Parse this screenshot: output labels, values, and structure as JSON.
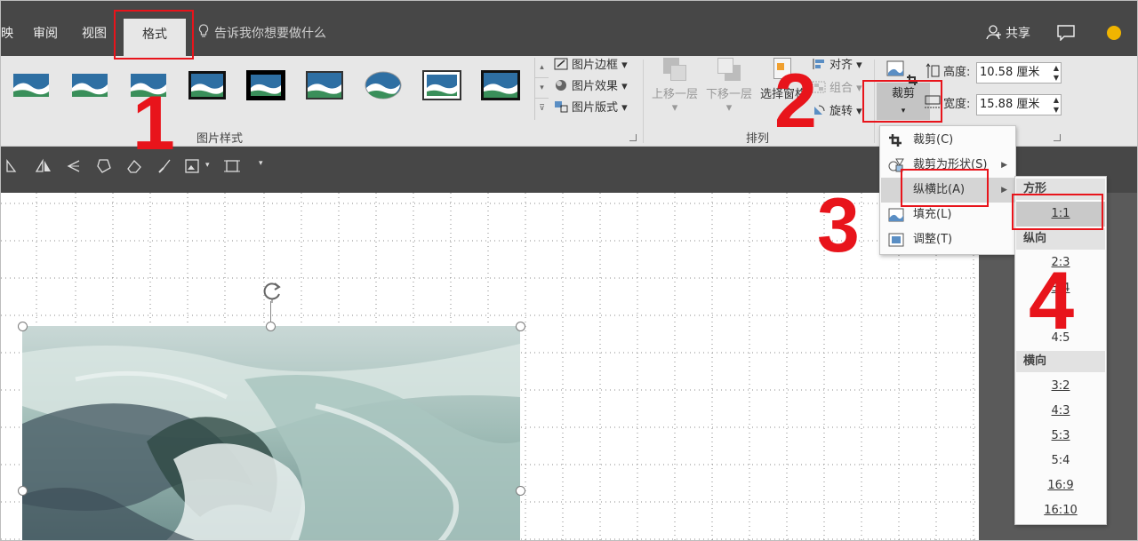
{
  "tabs": {
    "left_partial": "映",
    "review": "审阅",
    "view": "视图",
    "format": "格式",
    "tell_me": "告诉我你想要做什么",
    "share": "共享"
  },
  "ribbon": {
    "picture_styles_label": "图片样式",
    "picture_border": "图片边框",
    "picture_effects": "图片效果",
    "picture_layout": "图片版式",
    "arrange_label": "排列",
    "bring_forward": "上移一层",
    "send_backward": "下移一层",
    "selection_pane": "选择窗格",
    "align": "对齐",
    "group": "组合",
    "rotate": "旋转",
    "crop": "裁剪",
    "height_label": "高度:",
    "height_value": "10.58 厘米",
    "width_label": "宽度:",
    "width_value": "15.88 厘米"
  },
  "crop_menu": {
    "items": [
      {
        "label": "裁剪(C)",
        "icon": "crop-icon"
      },
      {
        "label": "裁剪为形状(S)",
        "icon": "shape-icon"
      },
      {
        "label": "纵横比(A)",
        "icon": ""
      },
      {
        "label": "填充(L)",
        "icon": "fill-picture-icon"
      },
      {
        "label": "调整(T)",
        "icon": "fit-picture-icon"
      }
    ]
  },
  "ratio_menu": {
    "square_header": "方形",
    "square_items": [
      "1:1"
    ],
    "portrait_header": "纵向",
    "portrait_items": [
      "2:3",
      "3:4",
      "4:5"
    ],
    "landscape_header": "横向",
    "landscape_items": [
      "3:2",
      "4:3",
      "5:3",
      "5:4",
      "16:9",
      "16:10"
    ]
  },
  "annotations": {
    "step1": "1",
    "step2": "2",
    "step3": "3",
    "step4": "4",
    "color": "#e8141b"
  },
  "colors": {
    "titlebar": "#474747",
    "ribbon": "#e7e7e7",
    "right_pane": "#5a5a5a"
  }
}
